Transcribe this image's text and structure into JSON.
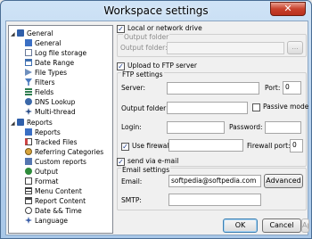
{
  "window": {
    "title": "Workspace settings",
    "close_glyph": "✕"
  },
  "tree": {
    "general": {
      "label": "General",
      "items": [
        "General",
        "Log file storage",
        "Date Range",
        "File Types",
        "Filters",
        "Fields",
        "DNS Lookup",
        "Multi-thread"
      ]
    },
    "reports": {
      "label": "Reports",
      "items": [
        "Reports",
        "Tracked Files",
        "Referring Categories",
        "Custom reports",
        "Output",
        "Format",
        "Menu Content",
        "Report Content",
        "Date && Time",
        "Language"
      ]
    }
  },
  "local": {
    "checkbox_label": "Local or network drive",
    "group_label": "Output folder",
    "field_label": "Output folder:",
    "browse_label": "..."
  },
  "ftp": {
    "checkbox_label": "Upload to FTP server",
    "group_label": "FTP settings",
    "server_label": "Server:",
    "port_label": "Port:",
    "port_value": "0",
    "output_folder_label": "Output folder:",
    "passive_label": "Passive mode",
    "login_label": "Login:",
    "password_label": "Password:",
    "firewall_label": "Use firewall",
    "firewall_port_label": "Firewall port:",
    "firewall_port_value": "0"
  },
  "email": {
    "checkbox_label": "send via e-mail",
    "group_label": "Email settings",
    "email_label": "Email:",
    "email_value": "softpedia@softpedia.com",
    "advanced_label": "Advanced",
    "smtp_label": "SMTP:"
  },
  "buttons": {
    "ok": "OK",
    "cancel": "Cancel",
    "apply": "Apply"
  },
  "check_glyph": "✓"
}
